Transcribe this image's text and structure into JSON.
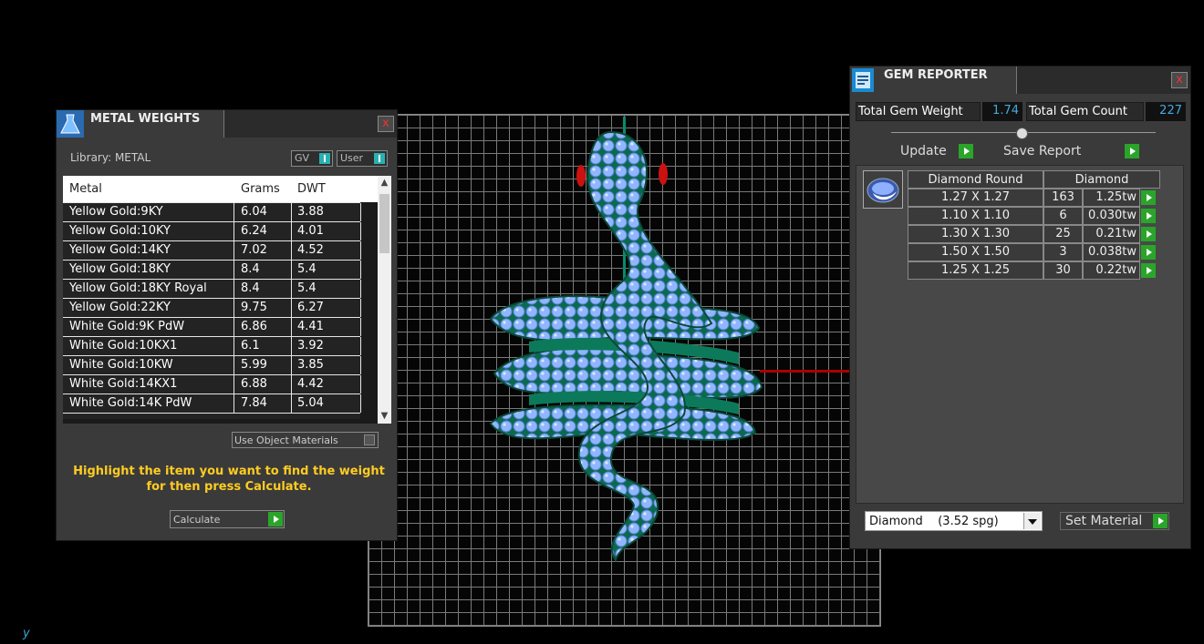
{
  "metal_weights": {
    "title": "METAL WEIGHTS",
    "close_label": "x",
    "library_label": "Library: METAL",
    "toggle_gv": "GV",
    "toggle_user": "User",
    "columns": [
      "Metal",
      "Grams",
      "DWT"
    ],
    "rows": [
      [
        "Yellow Gold:9KY",
        "6.04",
        "3.88"
      ],
      [
        "Yellow Gold:10KY",
        "6.24",
        "4.01"
      ],
      [
        "Yellow Gold:14KY",
        "7.02",
        "4.52"
      ],
      [
        "Yellow Gold:18KY",
        "8.4",
        "5.4"
      ],
      [
        "Yellow Gold:18KY Royal",
        "8.4",
        "5.4"
      ],
      [
        "Yellow Gold:22KY",
        "9.75",
        "6.27"
      ],
      [
        "White Gold:9K PdW",
        "6.86",
        "4.41"
      ],
      [
        "White Gold:10KX1",
        "6.1",
        "3.92"
      ],
      [
        "White Gold:10KW",
        "5.99",
        "3.85"
      ],
      [
        "White Gold:14KX1",
        "6.88",
        "4.42"
      ],
      [
        "White Gold:14K PdW",
        "7.84",
        "5.04"
      ]
    ],
    "use_object_materials": "Use Object Materials",
    "hint": "Highlight the item you want to find the weight for then press Calculate.",
    "calculate_label": "Calculate"
  },
  "gem_reporter": {
    "title": "GEM REPORTER",
    "close_label": "x",
    "total_weight_label": "Total Gem Weight",
    "total_weight_value": "1.74",
    "total_count_label": "Total Gem Count",
    "total_count_value": "227",
    "update_label": "Update",
    "save_report_label": "Save Report",
    "headers": [
      "Diamond Round",
      "Diamond"
    ],
    "rows": [
      [
        "1.27 X 1.27",
        "163",
        "1.25tw"
      ],
      [
        "1.10 X 1.10",
        "6",
        "0.030tw"
      ],
      [
        "1.30 X 1.30",
        "25",
        "0.21tw"
      ],
      [
        "1.50 X 1.50",
        "3",
        "0.038tw"
      ],
      [
        "1.25 X 1.25",
        "30",
        "0.22tw"
      ]
    ],
    "material_selected": "Diamond    (3.52 spg)",
    "set_material_label": "Set Material"
  },
  "corner_glyph": "y",
  "colors": {
    "accent_green": "#2aa52a",
    "toggle_cyan": "#2ab0b0",
    "hint_yellow": "#ffcc22",
    "value_blue": "#44aadd"
  }
}
